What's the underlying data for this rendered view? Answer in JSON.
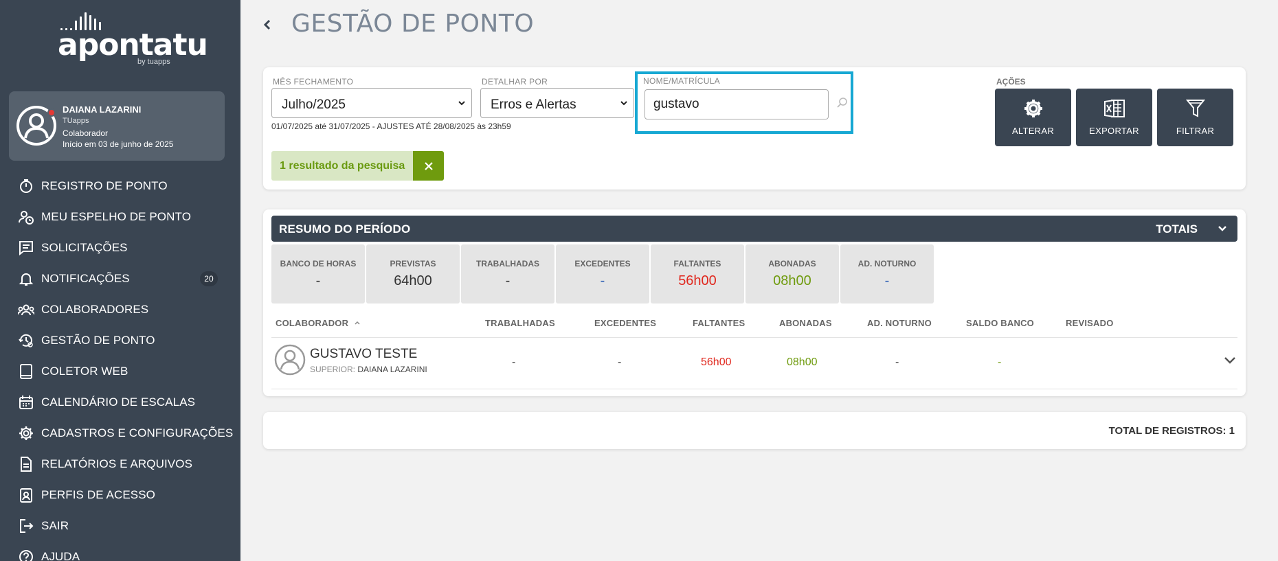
{
  "brand": {
    "name": "apontatu",
    "byline": "by tuapps"
  },
  "user": {
    "name": "DAIANA LAZARINI",
    "company": "TUapps",
    "role": "Colaborador",
    "start": "Início em 03 de junho de 2025"
  },
  "nav": [
    {
      "label": "REGISTRO DE PONTO",
      "icon": "stopwatch-icon"
    },
    {
      "label": "MEU ESPELHO DE PONTO",
      "icon": "user-clock-icon"
    },
    {
      "label": "SOLICITAÇÕES",
      "icon": "requests-icon"
    },
    {
      "label": "NOTIFICAÇÕES",
      "icon": "bell-icon",
      "badge": "20"
    },
    {
      "label": "COLABORADORES",
      "icon": "users-icon"
    },
    {
      "label": "GESTÃO DE PONTO",
      "icon": "clock-history-icon"
    },
    {
      "label": "COLETOR WEB",
      "icon": "tablet-icon"
    },
    {
      "label": "CALENDÁRIO DE ESCALAS",
      "icon": "calendar-icon"
    },
    {
      "label": "CADASTROS E CONFIGURAÇÕES",
      "icon": "gear-icon"
    },
    {
      "label": "RELATÓRIOS E ARQUIVOS",
      "icon": "document-icon"
    },
    {
      "label": "PERFIS DE ACESSO",
      "icon": "id-badge-icon"
    },
    {
      "label": "SAIR",
      "icon": "logout-icon"
    },
    {
      "label": "AJUDA",
      "icon": "help-icon"
    }
  ],
  "page": {
    "title": "GESTÃO DE PONTO"
  },
  "filters": {
    "mes_label": "MÊS FECHAMENTO",
    "mes_value": "Julho/2025",
    "detalhar_label": "DETALHAR POR",
    "detalhar_value": "Erros e Alertas",
    "nome_label": "NOME/MATRÍCULA",
    "nome_value": "gustavo",
    "date_range": "01/07/2025  até  31/07/2025 - AJUSTES ATÉ 28/08/2025 às 23h59",
    "result_text": "1 resultado da pesquisa"
  },
  "actions": {
    "label": "AÇÕES",
    "alterar": "ALTERAR",
    "exportar": "EXPORTAR",
    "filtrar": "FILTRAR"
  },
  "resumo": {
    "title": "RESUMO DO PERÍODO",
    "totais": "TOTAIS",
    "stats": [
      {
        "label": "BANCO DE HORAS",
        "value": "-",
        "color": "#333333"
      },
      {
        "label": "PREVISTAS",
        "value": "64h00",
        "color": "#333333"
      },
      {
        "label": "TRABALHADAS",
        "value": "-",
        "color": "#333333"
      },
      {
        "label": "EXCEDENTES",
        "value": "-",
        "color": "#2d5fb5"
      },
      {
        "label": "FALTANTES",
        "value": "56h00",
        "color": "#e0281e"
      },
      {
        "label": "ABONADAS",
        "value": "08h00",
        "color": "#6f9b0e"
      },
      {
        "label": "AD. NOTURNO",
        "value": "-",
        "color": "#2d5fb5"
      }
    ]
  },
  "table": {
    "headers": [
      "COLABORADOR",
      "TRABALHADAS",
      "EXCEDENTES",
      "FALTANTES",
      "ABONADAS",
      "AD. NOTURNO",
      "SALDO BANCO",
      "REVISADO"
    ],
    "rows": [
      {
        "name": "GUSTAVO TESTE",
        "superior_label": "SUPERIOR:",
        "superior": "DAIANA LAZARINI",
        "trabalhadas": "-",
        "excedentes": "-",
        "faltantes": "56h00",
        "abonadas": "08h00",
        "ad_noturno": "-",
        "saldo_banco": "-",
        "revisado": ""
      }
    ]
  },
  "footer": {
    "total": "TOTAL DE REGISTROS: 1"
  },
  "colors": {
    "sidebar": "#3a4552",
    "accent_search": "#17a8d3",
    "green": "#6f9b0e",
    "red": "#e0281e",
    "blue": "#2d5fb5"
  }
}
